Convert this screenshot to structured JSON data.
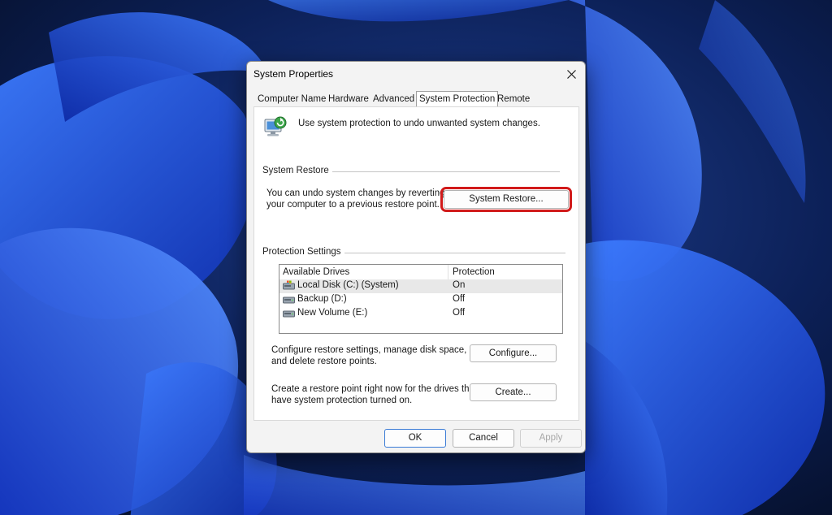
{
  "dialog": {
    "title": "System Properties",
    "tabs": [
      {
        "label": "Computer Name"
      },
      {
        "label": "Hardware"
      },
      {
        "label": "Advanced"
      },
      {
        "label": "System Protection",
        "active": true
      },
      {
        "label": "Remote"
      }
    ],
    "intro_text": "Use system protection to undo unwanted system changes.",
    "system_restore": {
      "heading": "System Restore",
      "description_line1": "You can undo system changes by reverting",
      "description_line2": "your computer to a previous restore point.",
      "button_label": "System Restore..."
    },
    "protection_settings": {
      "heading": "Protection Settings",
      "columns": [
        "Available Drives",
        "Protection"
      ],
      "drives": [
        {
          "name": "Local Disk (C:) (System)",
          "protection": "On",
          "icon": "system-drive-icon",
          "selected": true
        },
        {
          "name": "Backup (D:)",
          "protection": "Off",
          "icon": "drive-icon"
        },
        {
          "name": "New Volume (E:)",
          "protection": "Off",
          "icon": "drive-icon"
        }
      ],
      "configure_text_line1": "Configure restore settings, manage disk space,",
      "configure_text_line2": "and delete restore points.",
      "configure_button": "Configure...",
      "create_text_line1": "Create a restore point right now for the drives that",
      "create_text_line2": "have system protection turned on.",
      "create_button": "Create..."
    },
    "buttons": {
      "ok": "OK",
      "cancel": "Cancel",
      "apply": "Apply"
    }
  },
  "colors": {
    "highlight_border": "#d11a1a",
    "wallpaper_blue": "#1a4fd6",
    "dialog_background": "#f3f3f3"
  }
}
